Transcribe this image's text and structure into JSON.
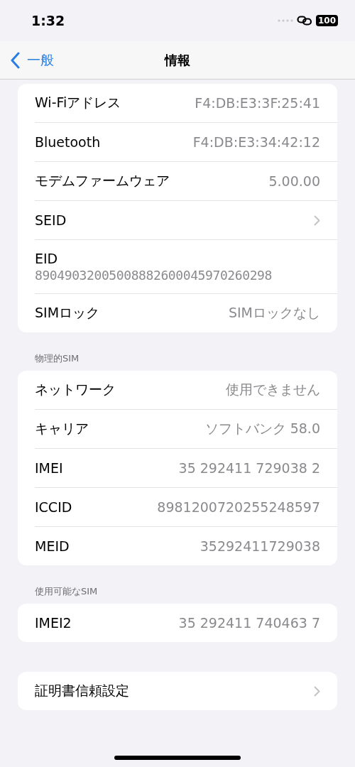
{
  "status_bar": {
    "time": "1:32",
    "battery": "100"
  },
  "nav": {
    "back": "一般",
    "title": "情報"
  },
  "sections": [
    {
      "rows": [
        {
          "kind": "value",
          "label": "Wi-Fiアドレス",
          "value": "F4:DB:E3:3F:25:41"
        },
        {
          "kind": "value",
          "label": "Bluetooth",
          "value": "F4:DB:E3:34:42:12"
        },
        {
          "kind": "value",
          "label": "モデムファームウェア",
          "value": "5.00.00"
        },
        {
          "kind": "chevron",
          "label": "SEID"
        },
        {
          "kind": "stacked",
          "label": "EID",
          "value": "89049032005008882600045970260298"
        },
        {
          "kind": "value",
          "label": "SIMロック",
          "value": "SIMロックなし"
        }
      ]
    },
    {
      "header": "物理的SIM",
      "rows": [
        {
          "kind": "value",
          "label": "ネットワーク",
          "value": "使用できません"
        },
        {
          "kind": "value",
          "label": "キャリア",
          "value": "ソフトバンク 58.0"
        },
        {
          "kind": "value",
          "label": "IMEI",
          "value": "35 292411 729038 2"
        },
        {
          "kind": "value",
          "label": "ICCID",
          "value": "8981200720255248597"
        },
        {
          "kind": "value",
          "label": "MEID",
          "value": "35292411729038"
        }
      ]
    },
    {
      "header": "使用可能なSIM",
      "rows": [
        {
          "kind": "value",
          "label": "IMEI2",
          "value": "35 292411 740463 7"
        }
      ]
    },
    {
      "rows": [
        {
          "kind": "chevron",
          "label": "証明書信頼設定"
        }
      ]
    }
  ]
}
